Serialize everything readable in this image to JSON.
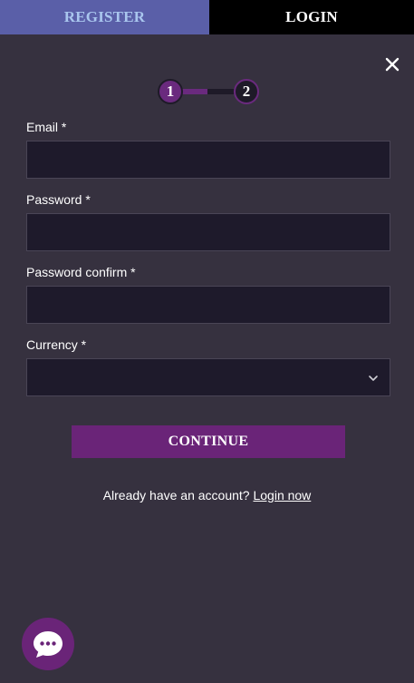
{
  "tabs": {
    "register_label": "REGISTER",
    "login_label": "LOGIN"
  },
  "steps": {
    "step1": "1",
    "step2": "2",
    "current_step": 1,
    "total_steps": 2
  },
  "form": {
    "email_label": "Email *",
    "email_value": "",
    "password_label": "Password *",
    "password_value": "",
    "password_confirm_label": "Password confirm *",
    "password_confirm_value": "",
    "currency_label": "Currency *",
    "currency_value": "",
    "continue_label": "CONTINUE"
  },
  "footer": {
    "login_prompt": "Already have an account?",
    "login_link": "Login now"
  },
  "icons": {
    "close": "close-icon",
    "chevron": "chevron-down-icon",
    "chat": "chat-icon"
  },
  "colors": {
    "background": "#36313f",
    "accent": "#6a2478",
    "register_tab": "#5a5fa8",
    "login_tab": "#000000",
    "input_bg": "#1e1a2b"
  }
}
